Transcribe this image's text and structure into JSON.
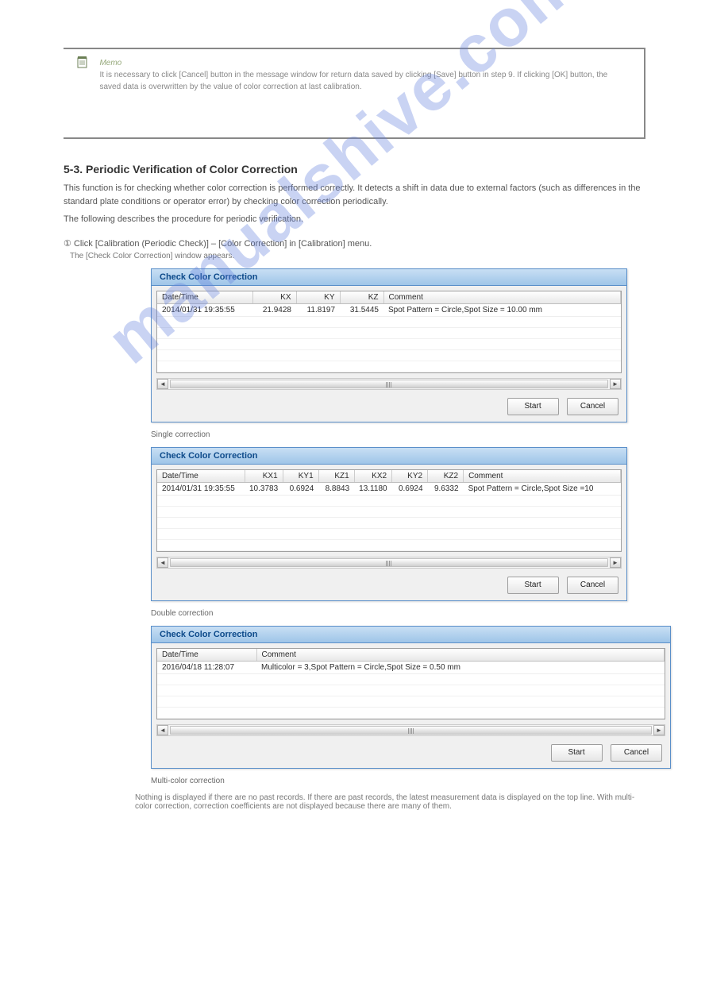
{
  "note": {
    "memo_label": "Memo",
    "text": "It is necessary to click [Cancel] button in the message window for return data saved by clicking [Save] button in step 9. If clicking [OK] button, the saved data is overwritten by the value of color correction at last calibration."
  },
  "section": {
    "title": "5-3. Periodic Verification of Color Correction",
    "p1": "This function is for checking whether color correction is performed correctly. It detects a shift in data due to external factors (such as differences in the standard plate conditions or operator error) by checking color correction periodically.",
    "p2": "The following describes the procedure for periodic verification.",
    "step1": "Click [Calibration (Periodic Check)] – [Color Correction] in [Calibration] menu.",
    "step1_sub": "The [Check Color Correction] window appears.",
    "step1_num": "①"
  },
  "dialog1": {
    "title": "Check Color Correction",
    "headers": [
      "Date/Time",
      "KX",
      "KY",
      "KZ",
      "Comment"
    ],
    "row": {
      "datetime": "2014/01/31 19:35:55",
      "kx": "21.9428",
      "ky": "11.8197",
      "kz": "31.5445",
      "comment": "Spot Pattern = Circle,Spot Size = 10.00 mm"
    },
    "start": "Start",
    "cancel": "Cancel"
  },
  "figure1": "Single correction",
  "dialog2": {
    "title": "Check Color Correction",
    "headers": [
      "Date/Time",
      "KX1",
      "KY1",
      "KZ1",
      "KX2",
      "KY2",
      "KZ2",
      "Comment"
    ],
    "row": {
      "datetime": "2014/01/31 19:35:55",
      "kx1": "10.3783",
      "ky1": "0.6924",
      "kz1": "8.8843",
      "kx2": "13.1180",
      "ky2": "0.6924",
      "kz2": "9.6332",
      "comment": "Spot Pattern = Circle,Spot Size =10"
    },
    "start": "Start",
    "cancel": "Cancel"
  },
  "figure2": "Double correction",
  "dialog3": {
    "title": "Check Color Correction",
    "headers": [
      "Date/Time",
      "Comment"
    ],
    "row": {
      "datetime": "2016/04/18 11:28:07",
      "comment": "Multicolor = 3,Spot Pattern = Circle,Spot Size = 0.50 mm"
    },
    "start": "Start",
    "cancel": "Cancel"
  },
  "figure3": "Multi-color correction",
  "final_note": "Nothing is displayed if there are no past records. If there are past records, the latest measurement data is displayed on the top line. With multi-color correction, correction coefficients are not displayed because there are many of them."
}
